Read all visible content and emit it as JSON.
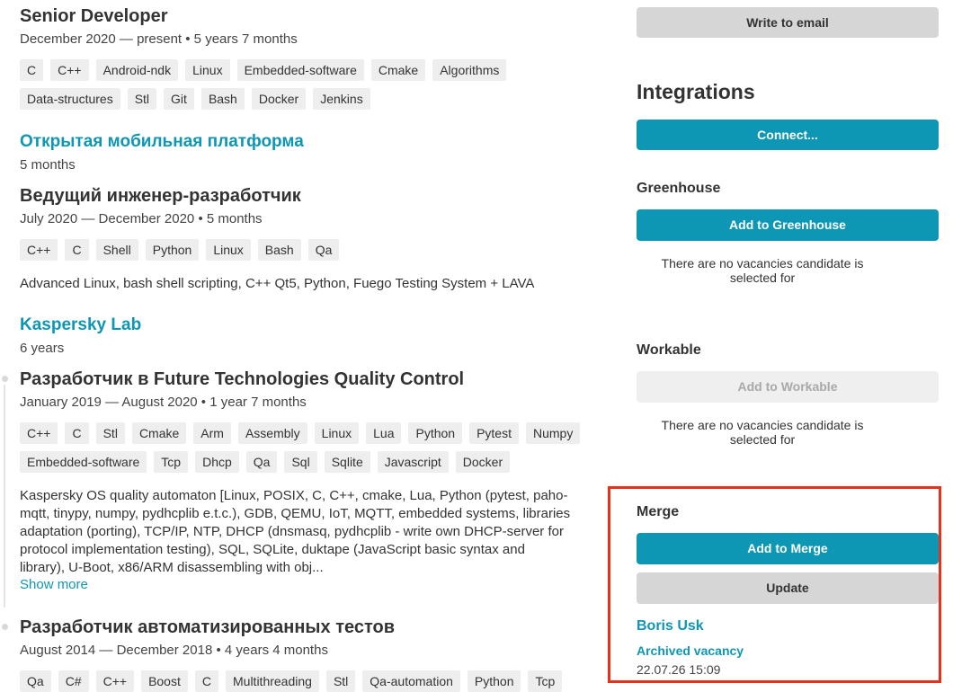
{
  "experience": {
    "senior": {
      "title": "Senior Developer",
      "meta": "December 2020 — present • 5 years 7 months",
      "tags_row1": [
        "C",
        "C++",
        "Android-ndk",
        "Linux",
        "Embedded-software",
        "Cmake",
        "Algorithms"
      ],
      "tags_row2": [
        "Data-structures",
        "Stl",
        "Git",
        "Bash",
        "Docker",
        "Jenkins"
      ]
    },
    "omp": {
      "company": "Открытая мобильная платформа",
      "duration": "5 months",
      "title": "Ведущий инженер-разработчик",
      "meta": "July 2020 — December 2020 • 5 months",
      "tags": [
        "C++",
        "C",
        "Shell",
        "Python",
        "Linux",
        "Bash",
        "Qa"
      ],
      "description": "Advanced Linux, bash shell scripting, C++ Qt5, Python, Fuego Testing System + LAVA"
    },
    "kaspersky": {
      "company": "Kaspersky Lab",
      "duration": "6 years",
      "role1": {
        "title": "Разработчик в Future Technologies Quality Control",
        "meta": "January 2019 — August 2020 • 1 year 7 months",
        "tags_row1": [
          "C++",
          "C",
          "Stl",
          "Cmake",
          "Arm",
          "Assembly",
          "Linux",
          "Lua",
          "Python",
          "Pytest",
          "Numpy"
        ],
        "tags_row2": [
          "Embedded-software",
          "Tcp",
          "Dhcp",
          "Qa",
          "Sql",
          "Sqlite",
          "Javascript",
          "Docker"
        ],
        "desc_lines": [
          "Kaspersky OS quality automaton [Linux, POSIX, C, C++, cmake, Lua, Python (pytest, paho-",
          "mqtt, tinypy, numpy, pydhcplib e.t.c.), GDB, QEMU, IoT, MQTT, embedded systems, libraries",
          "adaptation (porting), TCP/IP, NTP, DHCP (dnsmasq, pydhcplib - write own DHCP-server for",
          "protocol implementation testing), SQL, SQLite, duktape (JavaScript basic syntax and",
          "library), U-Boot, x86/ARM disassembling with obj..."
        ],
        "show_more": "Show more"
      },
      "role2": {
        "title": "Разработчик автоматизированных тестов",
        "meta": "August 2014 — December 2018 • 4 years 4 months",
        "tags": [
          "Qa",
          "C#",
          "C++",
          "Boost",
          "C",
          "Multithreading",
          "Stl",
          "Qa-automation",
          "Python",
          "Tcp"
        ]
      }
    }
  },
  "sidebar": {
    "write_email": "Write to email",
    "integrations_title": "Integrations",
    "connect_button": "Connect...",
    "greenhouse": {
      "title": "Greenhouse",
      "button": "Add to Greenhouse",
      "note": "There are no vacancies candidate is selected for"
    },
    "workable": {
      "title": "Workable",
      "button": "Add to Workable",
      "note": "There are no vacancies candidate is selected for"
    },
    "merge": {
      "title": "Merge",
      "add_button": "Add to Merge",
      "update_button": "Update",
      "user_name": "Boris Usk",
      "status": "Archived vacancy",
      "timestamp": "22.07.26 15:09"
    }
  },
  "colors": {
    "accent": "#0e96b5",
    "highlight": "#e8311a",
    "tag_bg": "#eeeeee",
    "gray_button": "#d6d6d6"
  }
}
